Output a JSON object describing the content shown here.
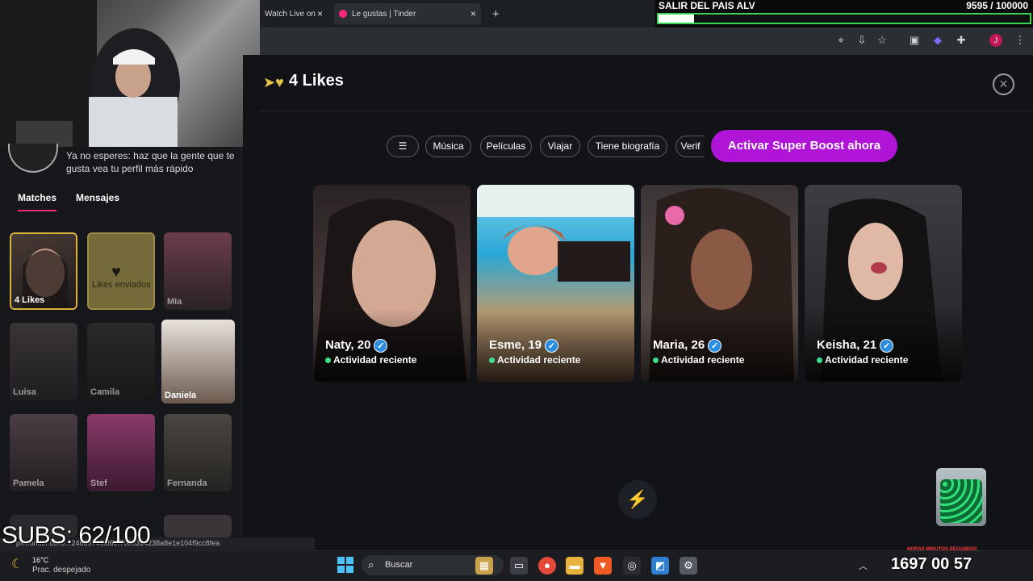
{
  "browser": {
    "tabs": [
      {
        "label": "Watch Live on",
        "close": "×"
      },
      {
        "label": "Le gustas | Tinder",
        "close": "×"
      }
    ],
    "new_tab": "+"
  },
  "overlay": {
    "goal_title": "SALIR DEL PAIS ALV",
    "goal_count": "9595 / 100000",
    "goal_progress": 0.096,
    "subs": "SUBS: 62/100",
    "bottom_tray": "1697  00  57",
    "tray_labels": "HORAS  MINUTOS  SEGUNDOS"
  },
  "sidebar": {
    "banner_text": "Ya no esperes: haz que la gente que te gusta vea tu perfil más rápido",
    "tabs": [
      {
        "label": "Matches"
      },
      {
        "label": "Mensajes"
      }
    ],
    "likes_card": {
      "label": "4 Likes"
    },
    "sent_card": {
      "label": "Likes enviados"
    },
    "matches": [
      {
        "name": "Mia"
      },
      {
        "name": "Luisa"
      },
      {
        "name": "Camila"
      },
      {
        "name": "Daniela"
      },
      {
        "name": "Pamela"
      },
      {
        "name": "Stef"
      },
      {
        "name": "Fernanda"
      }
    ]
  },
  "main": {
    "title": "4 Likes",
    "close_icon": "×",
    "filters": [
      "Música",
      "Películas",
      "Viajar",
      "Tiene biografía",
      "Verif"
    ],
    "boost_button": "Activar Super Boost ahora",
    "profiles": [
      {
        "name": "Naty, 20",
        "status": "Actividad reciente"
      },
      {
        "name": "Esme, 19",
        "status": "Actividad reciente"
      },
      {
        "name": "Maria, 26",
        "status": "Actividad reciente"
      },
      {
        "name": "Keisha, 21",
        "status": "Actividad reciente"
      }
    ]
  },
  "status_url": "ps://tinder.com/...24639746cf6ef7069314238a8e1e104f9cc8fea",
  "taskbar": {
    "weather_temp": "16°C",
    "weather_desc": "Prac. despejado",
    "search_placeholder": "Buscar"
  },
  "colors": {
    "accent_pink": "#fd267d",
    "boost_purple": "#b014d6",
    "verified_blue": "#2b8de0",
    "online_green": "#3ee08e",
    "goal_green": "#39d353"
  }
}
